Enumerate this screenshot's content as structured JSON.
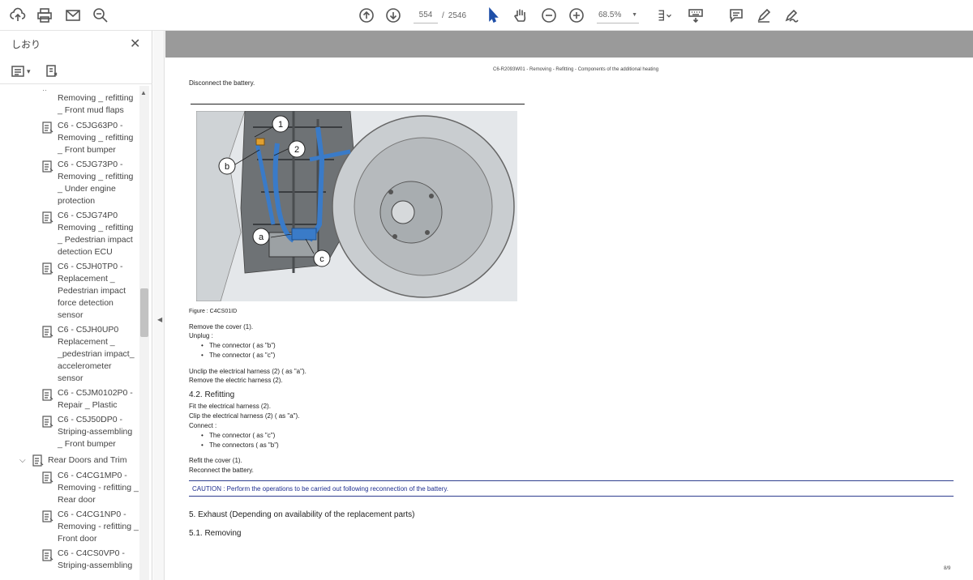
{
  "toolbar": {
    "page_current": "554",
    "page_separator": "/",
    "page_total": "2546",
    "zoom": "68.5%",
    "icons": [
      "upload-cloud-icon",
      "print-icon",
      "mail-icon",
      "zoom-search-icon",
      "page-up-icon",
      "page-down-icon",
      "select-pointer-icon",
      "hand-icon",
      "zoom-out-icon",
      "zoom-in-icon",
      "scroll-mode-icon",
      "keyboard-icon",
      "comment-icon",
      "highlight-pen-icon",
      "sign-icon"
    ]
  },
  "sidebar": {
    "title": "しおり",
    "close": "✕",
    "partial_top": "Removing _ refitting _ Front mud flaps",
    "items": [
      {
        "label": "C6 - C5JG63P0 - Removing _ refitting _ Front bumper"
      },
      {
        "label": "C6 - C5JG73P0 - Removing _ refitting _ Under engine protection"
      },
      {
        "label": "C6 - C5JG74P0 Removing _ refitting _ Pedestrian impact detection ECU"
      },
      {
        "label": "C6 - C5JH0TP0 - Replacement _ Pedestrian impact force detection sensor"
      },
      {
        "label": "C6 - C5JH0UP0 Replacement _ _pedestrian impact_ accelerometer sensor"
      },
      {
        "label": "C6 - C5JM0102P0 - Repair _ Plastic"
      },
      {
        "label": "C6 - C5J50DP0 - Striping-assembling _ Front bumper"
      }
    ],
    "folder": {
      "label": "Rear Doors and Trim",
      "chevron": "⌵"
    },
    "folder_items": [
      {
        "label": "C6 - C4CG1MP0 - Removing - refitting _ Rear door"
      },
      {
        "label": "C6 - C4CG1NP0 - Removing - refitting _ Front door"
      },
      {
        "label": "C6 - C4CS0VP0 - Striping-assembling"
      }
    ]
  },
  "document": {
    "running_header": "C6-R2093W01 - Removing - Refitting - Components of the additional heating",
    "disconnect": "Disconnect the battery.",
    "figure_labels": [
      "1",
      "2",
      "b",
      "a",
      "c"
    ],
    "caption": "Figure : C4CS01ID",
    "remove_cover": "Remove the cover (1).",
    "unplug": "Unplug :",
    "unplug_b": "The connector ( as \"b\")",
    "unplug_c": "The connector ( as \"c\")",
    "unclip": "Unclip the electrical harness (2) ( as \"a\").",
    "remove_harness": "Remove the electric harness (2).",
    "refitting_heading": "4.2. Refitting",
    "fit_harness": "Fit the electrical harness (2).",
    "clip_harness": "Clip the electrical harness (2) ( as \"a\").",
    "connect": "Connect :",
    "connect_c": "The connector ( as \"c\")",
    "connect_b": "The connectors ( as \"b\")",
    "refit_cover": "Refit the cover (1).",
    "reconnect": "Reconnect the battery.",
    "caution": "CAUTION : Perform the operations to be carried out following reconnection of the battery.",
    "exhaust_heading": "5. Exhaust (Depending on availability of the replacement parts)",
    "removing_heading": "5.1. Removing",
    "page_number": "8/9"
  }
}
